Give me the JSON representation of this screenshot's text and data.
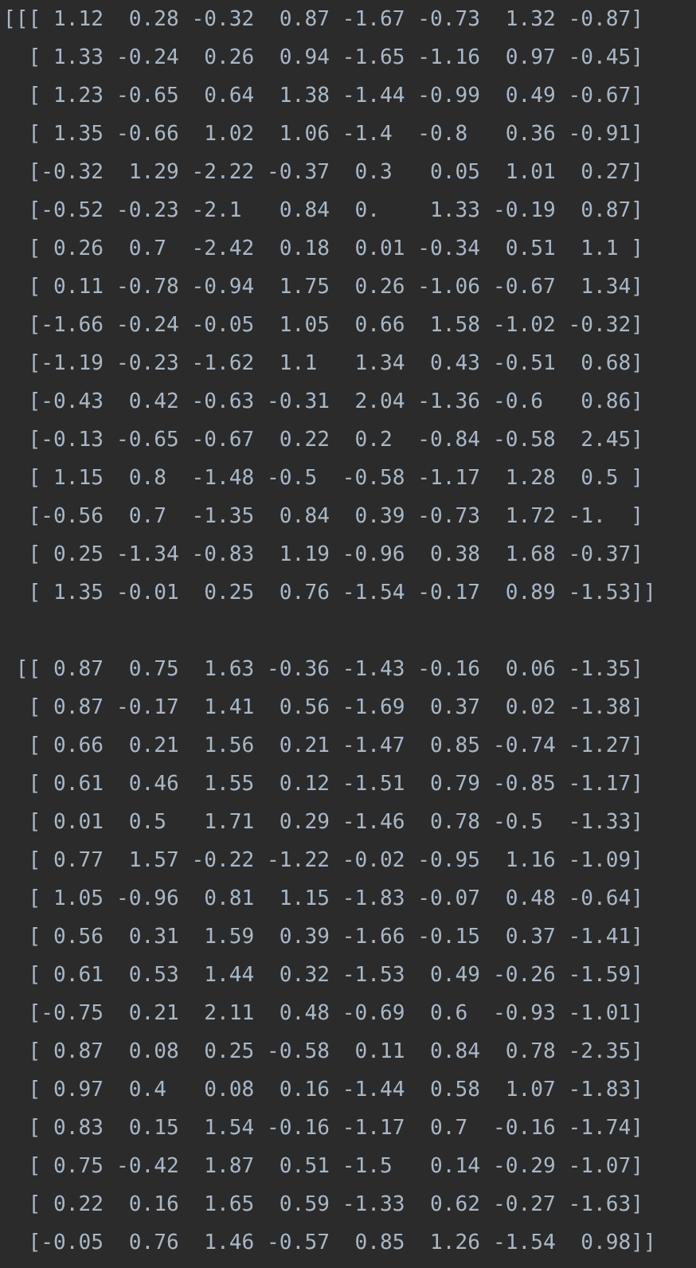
{
  "output_blocks": [
    {
      "lines": [
        "[[[ 1.12  0.28 -0.32  0.87 -1.67 -0.73  1.32 -0.87]",
        "  [ 1.33 -0.24  0.26  0.94 -1.65 -1.16  0.97 -0.45]",
        "  [ 1.23 -0.65  0.64  1.38 -1.44 -0.99  0.49 -0.67]",
        "  [ 1.35 -0.66  1.02  1.06 -1.4  -0.8   0.36 -0.91]",
        "  [-0.32  1.29 -2.22 -0.37  0.3   0.05  1.01  0.27]",
        "  [-0.52 -0.23 -2.1   0.84  0.    1.33 -0.19  0.87]",
        "  [ 0.26  0.7  -2.42  0.18  0.01 -0.34  0.51  1.1 ]",
        "  [ 0.11 -0.78 -0.94  1.75  0.26 -1.06 -0.67  1.34]",
        "  [-1.66 -0.24 -0.05  1.05  0.66  1.58 -1.02 -0.32]",
        "  [-1.19 -0.23 -1.62  1.1   1.34  0.43 -0.51  0.68]",
        "  [-0.43  0.42 -0.63 -0.31  2.04 -1.36 -0.6   0.86]",
        "  [-0.13 -0.65 -0.67  0.22  0.2  -0.84 -0.58  2.45]",
        "  [ 1.15  0.8  -1.48 -0.5  -0.58 -1.17  1.28  0.5 ]",
        "  [-0.56  0.7  -1.35  0.84  0.39 -0.73  1.72 -1.  ]",
        "  [ 0.25 -1.34 -0.83  1.19 -0.96  0.38  1.68 -0.37]",
        "  [ 1.35 -0.01  0.25  0.76 -1.54 -0.17  0.89 -1.53]]"
      ]
    },
    {
      "lines": [
        " [[ 0.87  0.75  1.63 -0.36 -1.43 -0.16  0.06 -1.35]",
        "  [ 0.87 -0.17  1.41  0.56 -1.69  0.37  0.02 -1.38]",
        "  [ 0.66  0.21  1.56  0.21 -1.47  0.85 -0.74 -1.27]",
        "  [ 0.61  0.46  1.55  0.12 -1.51  0.79 -0.85 -1.17]",
        "  [ 0.01  0.5   1.71  0.29 -1.46  0.78 -0.5  -1.33]",
        "  [ 0.77  1.57 -0.22 -1.22 -0.02 -0.95  1.16 -1.09]",
        "  [ 1.05 -0.96  0.81  1.15 -1.83 -0.07  0.48 -0.64]",
        "  [ 0.56  0.31  1.59  0.39 -1.66 -0.15  0.37 -1.41]",
        "  [ 0.61  0.53  1.44  0.32 -1.53  0.49 -0.26 -1.59]",
        "  [-0.75  0.21  2.11  0.48 -0.69  0.6  -0.93 -1.01]",
        "  [ 0.87  0.08  0.25 -0.58  0.11  0.84  0.78 -2.35]",
        "  [ 0.97  0.4   0.08  0.16 -1.44  0.58  1.07 -1.83]",
        "  [ 0.83  0.15  1.54 -0.16 -1.17  0.7  -0.16 -1.74]",
        "  [ 0.75 -0.42  1.87  0.51 -1.5   0.14 -0.29 -1.07]",
        "  [ 0.22  0.16  1.65  0.59 -1.33  0.62 -0.27 -1.63]",
        "  [-0.05  0.76  1.46 -0.57  0.85  1.26 -1.54  0.98]]"
      ]
    }
  ]
}
